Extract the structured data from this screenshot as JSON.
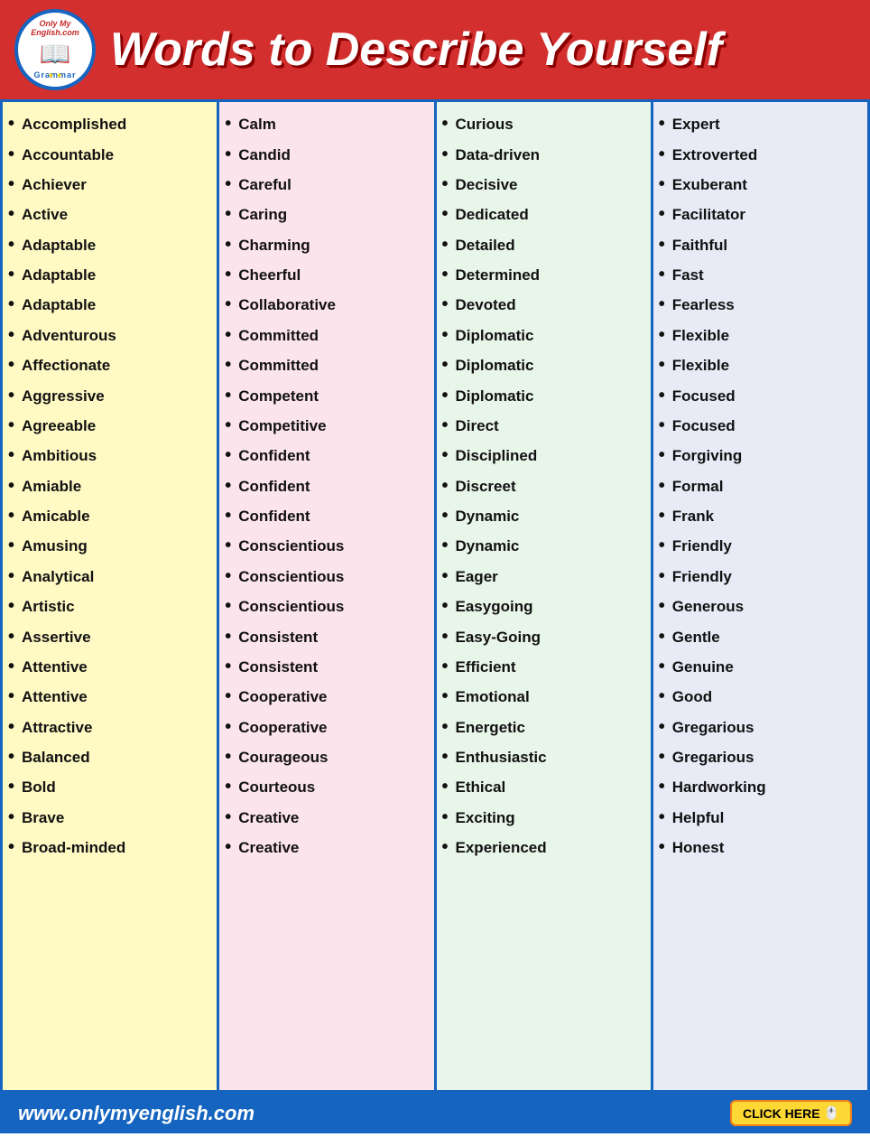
{
  "header": {
    "title": "Words to Describe Yourself",
    "logo_top": "Only My English.com",
    "logo_bottom": "Grammar",
    "logo_book": "📖"
  },
  "columns": [
    {
      "id": "col1",
      "items": [
        "Accomplished",
        "Accountable",
        "Achiever",
        "Active",
        "Adaptable",
        "Adaptable",
        "Adaptable",
        "Adventurous",
        "Affectionate",
        "Aggressive",
        "Agreeable",
        "Ambitious",
        "Amiable",
        "Amicable",
        "Amusing",
        "Analytical",
        "Artistic",
        "Assertive",
        "Attentive",
        "Attentive",
        "Attractive",
        "Balanced",
        "Bold",
        "Brave",
        "Broad-minded"
      ]
    },
    {
      "id": "col2",
      "items": [
        "Calm",
        "Candid",
        "Careful",
        "Caring",
        "Charming",
        "Cheerful",
        "Collaborative",
        "Committed",
        "Committed",
        "Competent",
        "Competitive",
        "Confident",
        "Confident",
        "Confident",
        "Conscientious",
        "Conscientious",
        "Conscientious",
        "Consistent",
        "Consistent",
        "Cooperative",
        "Cooperative",
        "Courageous",
        "Courteous",
        "Creative",
        "Creative"
      ]
    },
    {
      "id": "col3",
      "items": [
        "Curious",
        "Data-driven",
        "Decisive",
        "Dedicated",
        "Detailed",
        "Determined",
        "Devoted",
        "Diplomatic",
        "Diplomatic",
        "Diplomatic",
        "Direct",
        "Disciplined",
        "Discreet",
        "Dynamic",
        "Dynamic",
        "Eager",
        "Easygoing",
        "Easy-Going",
        "Efficient",
        "Emotional",
        "Energetic",
        "Enthusiastic",
        "Ethical",
        "Exciting",
        "Experienced"
      ]
    },
    {
      "id": "col4",
      "items": [
        "Expert",
        "Extroverted",
        "Exuberant",
        "Facilitator",
        "Faithful",
        "Fast",
        "Fearless",
        "Flexible",
        "Flexible",
        "Focused",
        "Focused",
        "Forgiving",
        "Formal",
        "Frank",
        "Friendly",
        "Friendly",
        "Generous",
        "Gentle",
        "Genuine",
        "Good",
        "Gregarious",
        "Gregarious",
        "Hardworking",
        "Helpful",
        "Honest"
      ]
    }
  ],
  "footer": {
    "url": "www.onlymyenglish.com",
    "button_label": "CLICK HERE"
  }
}
